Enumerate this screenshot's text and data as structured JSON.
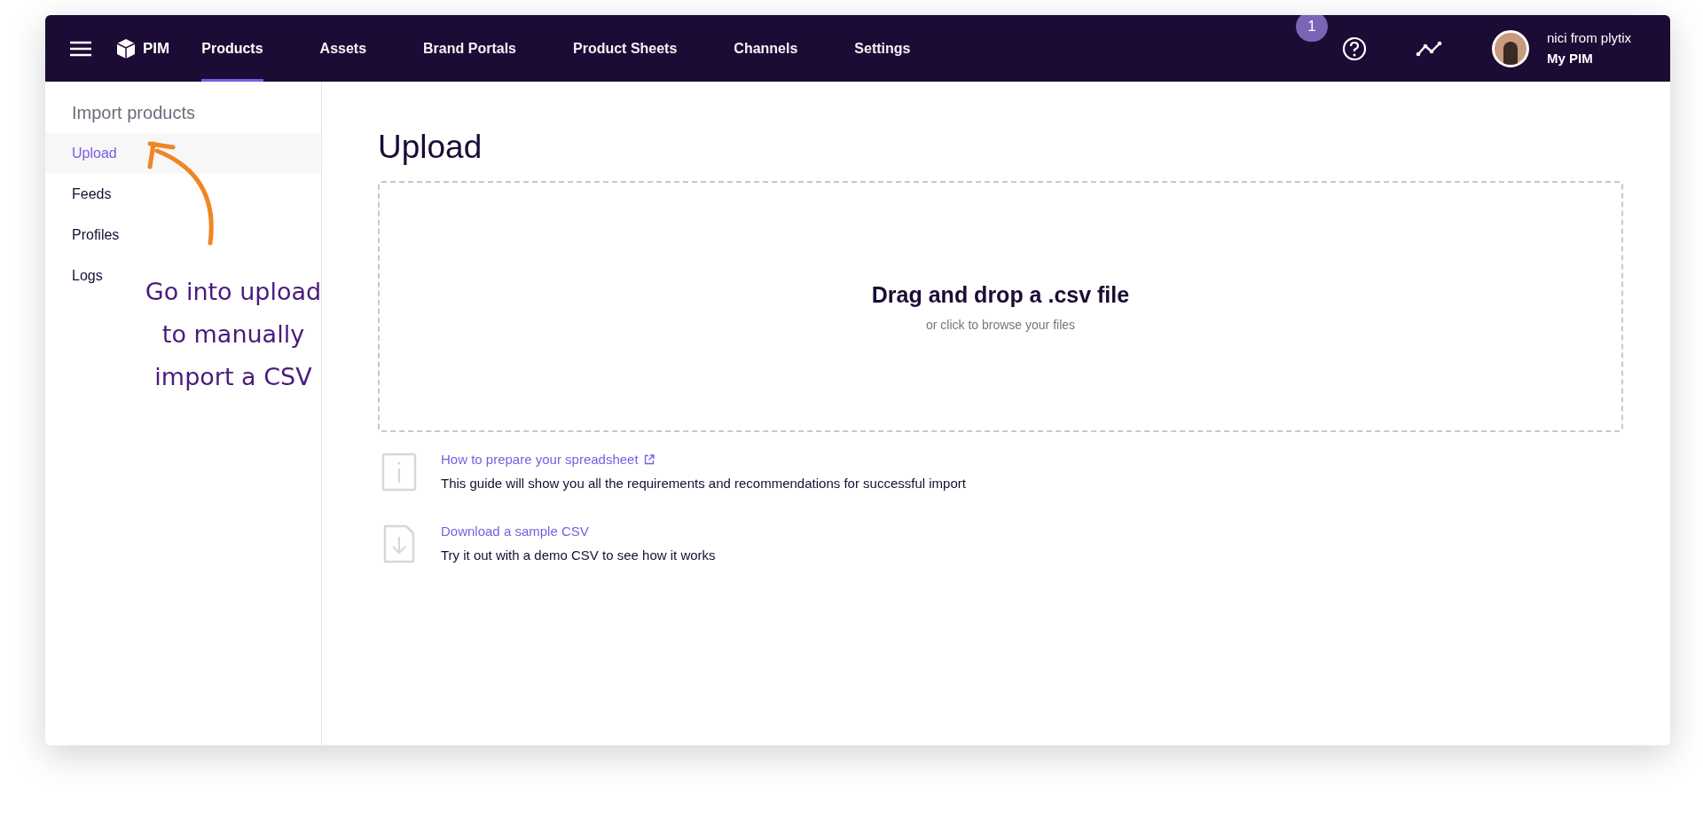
{
  "navbar": {
    "app_name": "PIM",
    "tabs": [
      {
        "label": "Products",
        "selected": true
      },
      {
        "label": "Assets",
        "selected": false
      },
      {
        "label": "Brand Portals",
        "selected": false
      },
      {
        "label": "Product Sheets",
        "selected": false
      },
      {
        "label": "Channels",
        "selected": false
      },
      {
        "label": "Settings",
        "selected": false
      }
    ],
    "notification_count": "1",
    "user": {
      "name": "nici from plytix",
      "account": "My PIM"
    }
  },
  "sidebar": {
    "title": "Import products",
    "items": [
      {
        "label": "Upload",
        "selected": true
      },
      {
        "label": "Feeds",
        "selected": false
      },
      {
        "label": "Profiles",
        "selected": false
      },
      {
        "label": "Logs",
        "selected": false
      }
    ]
  },
  "main": {
    "title": "Upload",
    "dropzone": {
      "heading": "Drag and drop a .csv file",
      "hint": "or click to browse your files"
    },
    "resources": [
      {
        "kind": "info",
        "link": "How to prepare your spreadsheet",
        "external": true,
        "description": "This guide will show you all the requirements and recommendations for successful import"
      },
      {
        "kind": "download",
        "link": "Download a sample CSV",
        "external": false,
        "description": "Try it out with a demo CSV to see how it works"
      }
    ]
  },
  "annotation": {
    "text": "Go into upload to manually import a CSV"
  }
}
